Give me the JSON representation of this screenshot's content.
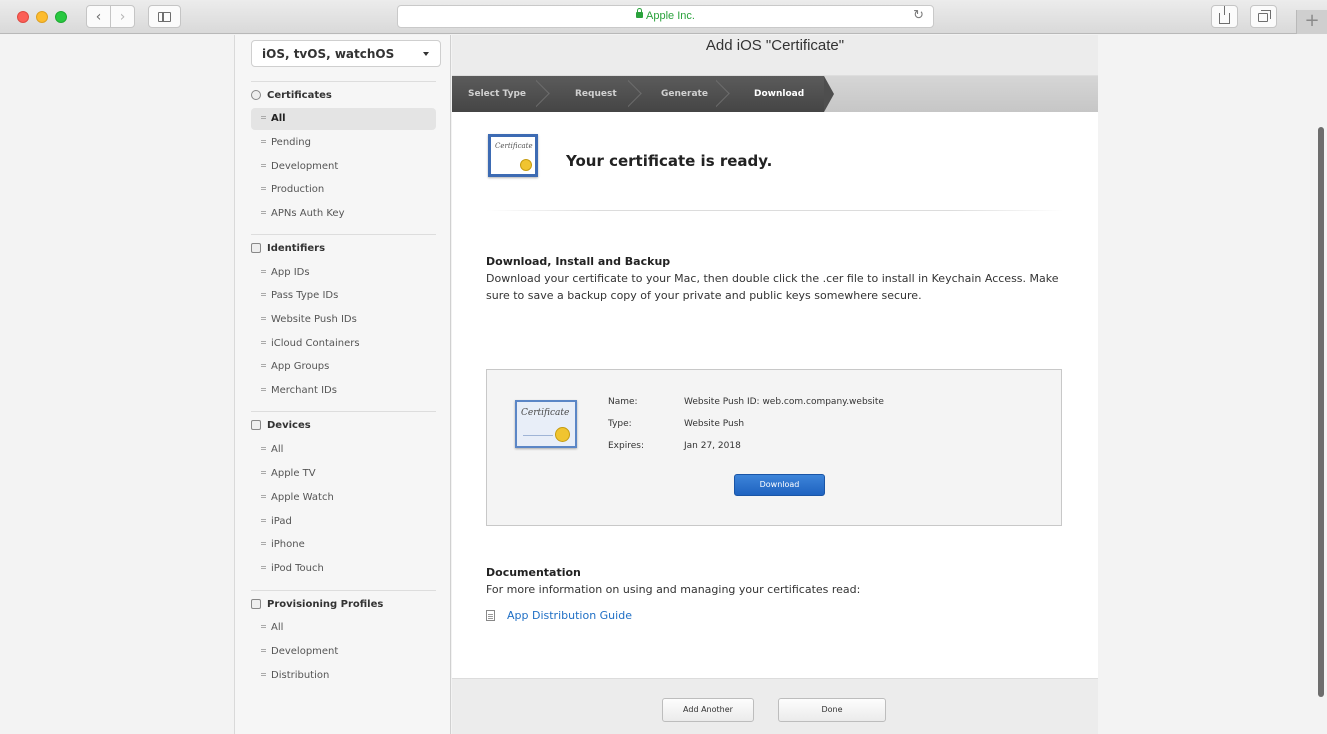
{
  "browser": {
    "address": "Apple Inc.",
    "reload_glyph": "↻",
    "new_tab_glyph": "+",
    "icons": [
      "back-icon",
      "forward-icon",
      "sidebar-icon",
      "lock-icon",
      "reload-icon",
      "share-icon",
      "tabs-icon",
      "plus-icon"
    ]
  },
  "sidebar": {
    "platform_select": "iOS, tvOS, watchOS",
    "sections": [
      {
        "title": "Certificates",
        "icon": "certificate-icon",
        "items": [
          "All",
          "Pending",
          "Development",
          "Production",
          "APNs Auth Key"
        ],
        "selected": 0
      },
      {
        "title": "Identifiers",
        "icon": "identifier-icon",
        "items": [
          "App IDs",
          "Pass Type IDs",
          "Website Push IDs",
          "iCloud Containers",
          "App Groups",
          "Merchant IDs"
        ]
      },
      {
        "title": "Devices",
        "icon": "device-icon",
        "items": [
          "All",
          "Apple TV",
          "Apple Watch",
          "iPad",
          "iPhone",
          "iPod Touch"
        ]
      },
      {
        "title": "Provisioning Profiles",
        "icon": "profile-icon",
        "items": [
          "All",
          "Development",
          "Distribution"
        ]
      }
    ]
  },
  "main": {
    "title": "Add iOS \"Certificate\"",
    "steps": [
      "Select Type",
      "Request",
      "Generate",
      "Download"
    ],
    "active_step": 3,
    "ready_text": "Your certificate is ready.",
    "cert_icon_script": "Certificate",
    "download_heading": "Download, Install and Backup",
    "download_desc": "Download your certificate to your Mac, then double click the .cer file to install in Keychain Access. Make sure to save a backup copy of your private and public keys somewhere secure.",
    "certificate": {
      "name_label": "Name:",
      "name_value": "Website Push ID: web.com.company.website",
      "type_label": "Type:",
      "type_value": "Website Push",
      "expires_label": "Expires:",
      "expires_value": "Jan 27, 2018",
      "download_button": "Download"
    },
    "doc_heading": "Documentation",
    "doc_desc": "For more information on using and managing your certificates read:",
    "doc_link": "App Distribution Guide",
    "footer": {
      "add_another": "Add Another",
      "done": "Done"
    }
  }
}
